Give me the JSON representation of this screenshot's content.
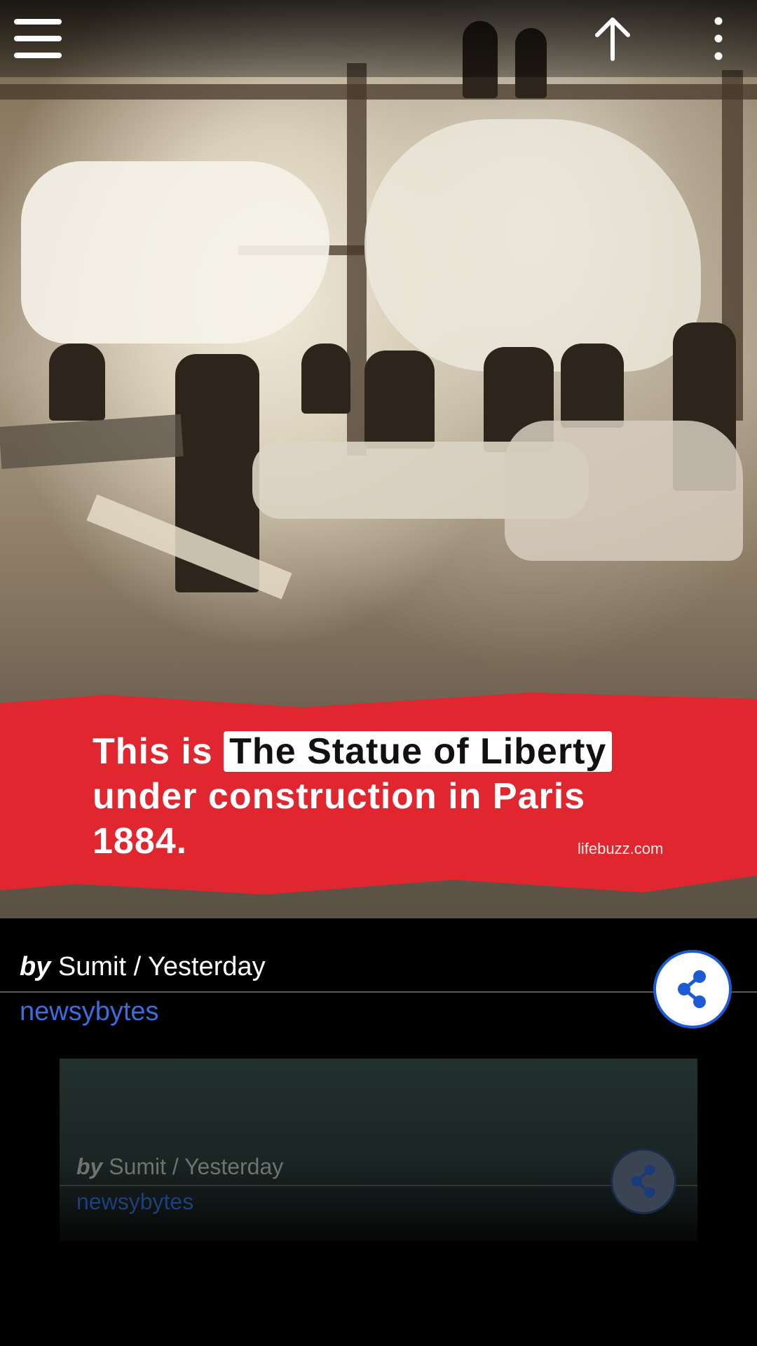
{
  "headline": {
    "prefix": "This is",
    "highlight": "The Statue of Liberty",
    "line2": "under construction in Paris",
    "line3": "1884.",
    "watermark": "lifebuzz.com"
  },
  "post": {
    "by_label": "by",
    "author_time": "Sumit / Yesterday",
    "source": "newsybytes"
  },
  "next_post": {
    "by_label": "by",
    "author_time": "Sumit / Yesterday",
    "source": "newsybytes"
  },
  "icons": {
    "menu": "hamburger-menu-icon",
    "scroll_up": "arrow-up-icon",
    "more": "more-vertical-icon",
    "share": "share-icon"
  },
  "colors": {
    "accent_blue": "#1d5bd6",
    "link_blue": "#3b6dde",
    "banner_red": "#e0262e"
  }
}
